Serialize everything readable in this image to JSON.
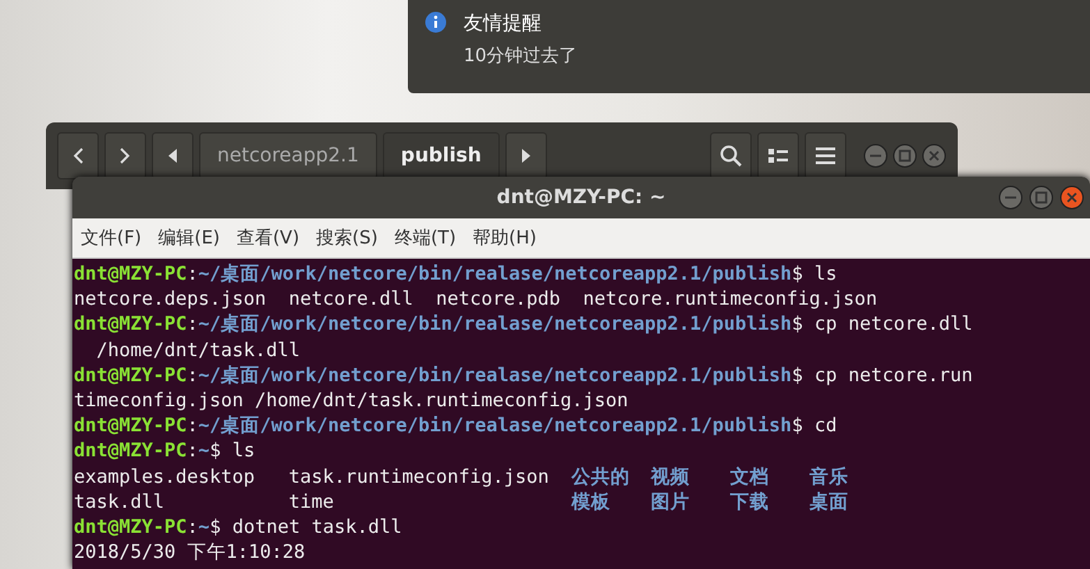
{
  "notification": {
    "title": "友情提醒",
    "body": "10分钟过去了"
  },
  "file_manager": {
    "path_buttons": [
      {
        "label": "netcoreapp2.1",
        "selected": false
      },
      {
        "label": "publish",
        "selected": true
      }
    ]
  },
  "terminal": {
    "title": "dnt@MZY-PC: ~",
    "menu": [
      "文件(F)",
      "编辑(E)",
      "查看(V)",
      "搜索(S)",
      "终端(T)",
      "帮助(H)"
    ],
    "lines": [
      {
        "kind": "prompt",
        "user": "dnt@MZY-PC",
        "colon": ":",
        "path": "~/桌面/work/netcore/bin/realase/netcoreapp2.1/publish",
        "command": "$ ls"
      },
      {
        "kind": "output",
        "text": "netcore.deps.json  netcore.dll  netcore.pdb  netcore.runtimeconfig.json"
      },
      {
        "kind": "prompt",
        "user": "dnt@MZY-PC",
        "colon": ":",
        "path": "~/桌面/work/netcore/bin/realase/netcoreapp2.1/publish",
        "command": "$ cp netcore.dll"
      },
      {
        "kind": "output",
        "text": "  /home/dnt/task.dll"
      },
      {
        "kind": "prompt",
        "user": "dnt@MZY-PC",
        "colon": ":",
        "path": "~/桌面/work/netcore/bin/realase/netcoreapp2.1/publish",
        "command": "$ cp netcore.run"
      },
      {
        "kind": "output",
        "text": "timeconfig.json /home/dnt/task.runtimeconfig.json"
      },
      {
        "kind": "prompt",
        "user": "dnt@MZY-PC",
        "colon": ":",
        "path": "~/桌面/work/netcore/bin/realase/netcoreapp2.1/publish",
        "command": "$ cd"
      },
      {
        "kind": "prompt",
        "user": "dnt@MZY-PC",
        "colon": ":",
        "path": "~",
        "command": "$ ls"
      },
      {
        "kind": "listing",
        "files": [
          "examples.desktop",
          "task.runtimeconfig.json"
        ],
        "dirs": [
          "公共的",
          "视频",
          "文档",
          "音乐"
        ]
      },
      {
        "kind": "listing",
        "files": [
          "task.dll",
          "time"
        ],
        "dirs": [
          "模板",
          "图片",
          "下载",
          "桌面"
        ]
      },
      {
        "kind": "prompt",
        "user": "dnt@MZY-PC",
        "colon": ":",
        "path": "~",
        "command": "$ dotnet task.dll"
      },
      {
        "kind": "output",
        "text": "2018/5/30 下午1:10:28"
      }
    ]
  }
}
